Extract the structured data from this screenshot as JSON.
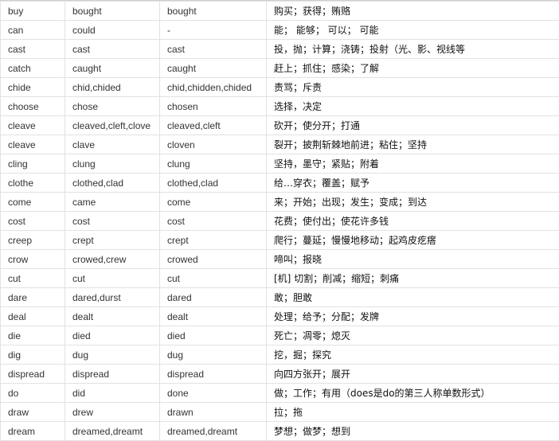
{
  "table": {
    "rows": [
      {
        "base": "buy",
        "past": "bought",
        "participle": "bought",
        "meaning": "购买；获得；贿赂"
      },
      {
        "base": "can",
        "past": "could",
        "participle": "-",
        "meaning": "能； 能够； 可以； 可能"
      },
      {
        "base": "cast",
        "past": "cast",
        "participle": "cast",
        "meaning": "投，抛；计算；浇铸；投射（光、影、视线等"
      },
      {
        "base": "catch",
        "past": "caught",
        "participle": "caught",
        "meaning": "赶上；抓住；感染；了解"
      },
      {
        "base": "chide",
        "past": "chid,chided",
        "participle": "chid,chidden,chided",
        "meaning": "责骂；斥责"
      },
      {
        "base": "choose",
        "past": "chose",
        "participle": "chosen",
        "meaning": "选择，决定"
      },
      {
        "base": "cleave",
        "past": "cleaved,cleft,clove",
        "participle": "cleaved,cleft",
        "meaning": "砍开；使分开；打通"
      },
      {
        "base": "cleave",
        "past": "clave",
        "participle": "cloven",
        "meaning": "裂开；披荆斩棘地前进；粘住；坚持"
      },
      {
        "base": "cling",
        "past": "clung",
        "participle": "clung",
        "meaning": "坚持，墨守；紧贴；附着"
      },
      {
        "base": "clothe",
        "past": "clothed,clad",
        "participle": "clothed,clad",
        "meaning": "给…穿衣；覆盖；赋予"
      },
      {
        "base": "come",
        "past": "came",
        "participle": "come",
        "meaning": "来；开始；出现；发生；变成；到达"
      },
      {
        "base": "cost",
        "past": "cost",
        "participle": "cost",
        "meaning": "花费；使付出；使花许多钱"
      },
      {
        "base": "creep",
        "past": "crept",
        "participle": "crept",
        "meaning": "爬行；蔓延；慢慢地移动；起鸡皮疙瘩"
      },
      {
        "base": "crow",
        "past": "crowed,crew",
        "participle": "crowed",
        "meaning": "啼叫；报晓"
      },
      {
        "base": "cut",
        "past": "cut",
        "participle": "cut",
        "meaning": "[机] 切割；削减；缩短；刺痛"
      },
      {
        "base": "dare",
        "past": "dared,durst",
        "participle": "dared",
        "meaning": "敢；胆敢"
      },
      {
        "base": "deal",
        "past": "dealt",
        "participle": "dealt",
        "meaning": "处理；给予；分配；发牌"
      },
      {
        "base": "die",
        "past": "died",
        "participle": "died",
        "meaning": "死亡；凋零；熄灭"
      },
      {
        "base": "dig",
        "past": "dug",
        "participle": "dug",
        "meaning": "挖，掘；探究"
      },
      {
        "base": "dispread",
        "past": "dispread",
        "participle": "dispread",
        "meaning": "向四方张开；展开"
      },
      {
        "base": "do",
        "past": "did",
        "participle": "done",
        "meaning": "做；工作；有用（does是do的第三人称单数形式）"
      },
      {
        "base": "draw",
        "past": "drew",
        "participle": "drawn",
        "meaning": "拉；拖"
      },
      {
        "base": "dream",
        "past": "dreamed,dreamt",
        "participle": "dreamed,dreamt",
        "meaning": "梦想；做梦；想到"
      }
    ]
  }
}
